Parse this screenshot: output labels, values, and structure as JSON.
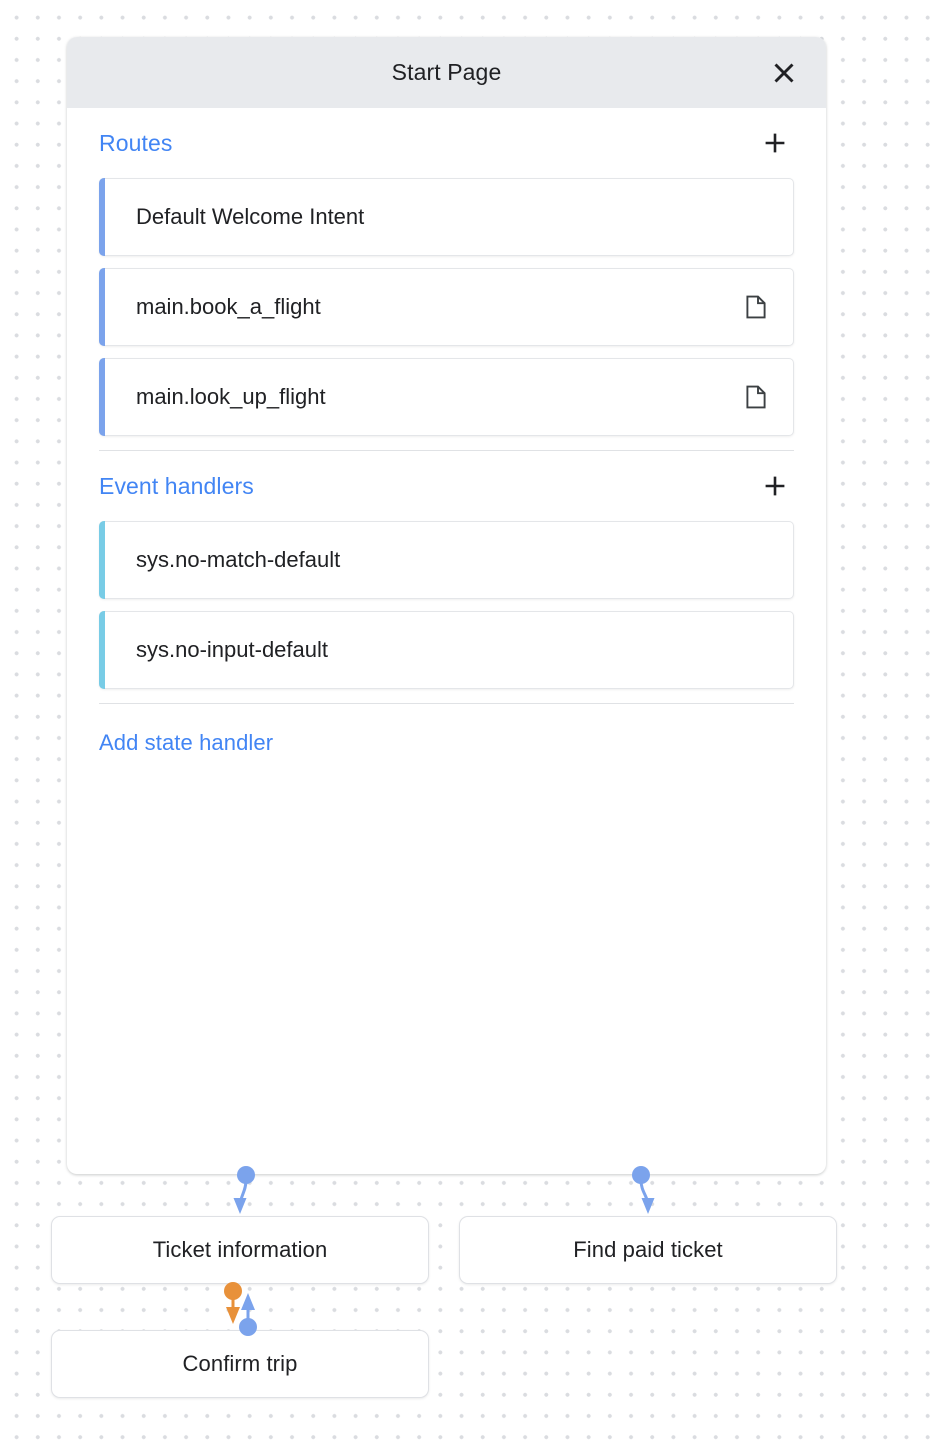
{
  "panel": {
    "title": "Start Page",
    "close_icon": "close-icon",
    "sections": [
      {
        "id": "routes",
        "title": "Routes",
        "add_icon": "plus-icon",
        "accent_color": "#7ba3ec",
        "items": [
          {
            "label": "Default Welcome Intent",
            "icon": null
          },
          {
            "label": "main.book_a_flight",
            "icon": "document-icon"
          },
          {
            "label": "main.look_up_flight",
            "icon": "document-icon"
          }
        ]
      },
      {
        "id": "event-handlers",
        "title": "Event handlers",
        "add_icon": "plus-icon",
        "accent_color": "#78cce6",
        "items": [
          {
            "label": "sys.no-match-default",
            "icon": null
          },
          {
            "label": "sys.no-input-default",
            "icon": null
          }
        ]
      }
    ],
    "add_state_handler": "Add state handler"
  },
  "flow": {
    "nodes": [
      {
        "id": "ticket-information",
        "label": "Ticket information"
      },
      {
        "id": "find-paid-ticket",
        "label": "Find paid ticket"
      },
      {
        "id": "confirm-trip",
        "label": "Confirm trip"
      }
    ],
    "edges": [
      {
        "from": "start-page",
        "to": "ticket-information",
        "color": "#7ba3ec",
        "direction": "down"
      },
      {
        "from": "start-page",
        "to": "find-paid-ticket",
        "color": "#7ba3ec",
        "direction": "down"
      },
      {
        "from": "ticket-information",
        "to": "confirm-trip",
        "color": "#e8913a",
        "direction": "down"
      },
      {
        "from": "confirm-trip",
        "to": "ticket-information",
        "color": "#7ba3ec",
        "direction": "up"
      }
    ]
  },
  "colors": {
    "accent_blue": "#4285f4",
    "route_bar": "#7ba3ec",
    "handler_bar": "#78cce6",
    "edge_blue": "#7ba3ec",
    "edge_orange": "#e8913a",
    "header_bg": "#e8eaed",
    "canvas_dot": "#dadce0"
  }
}
